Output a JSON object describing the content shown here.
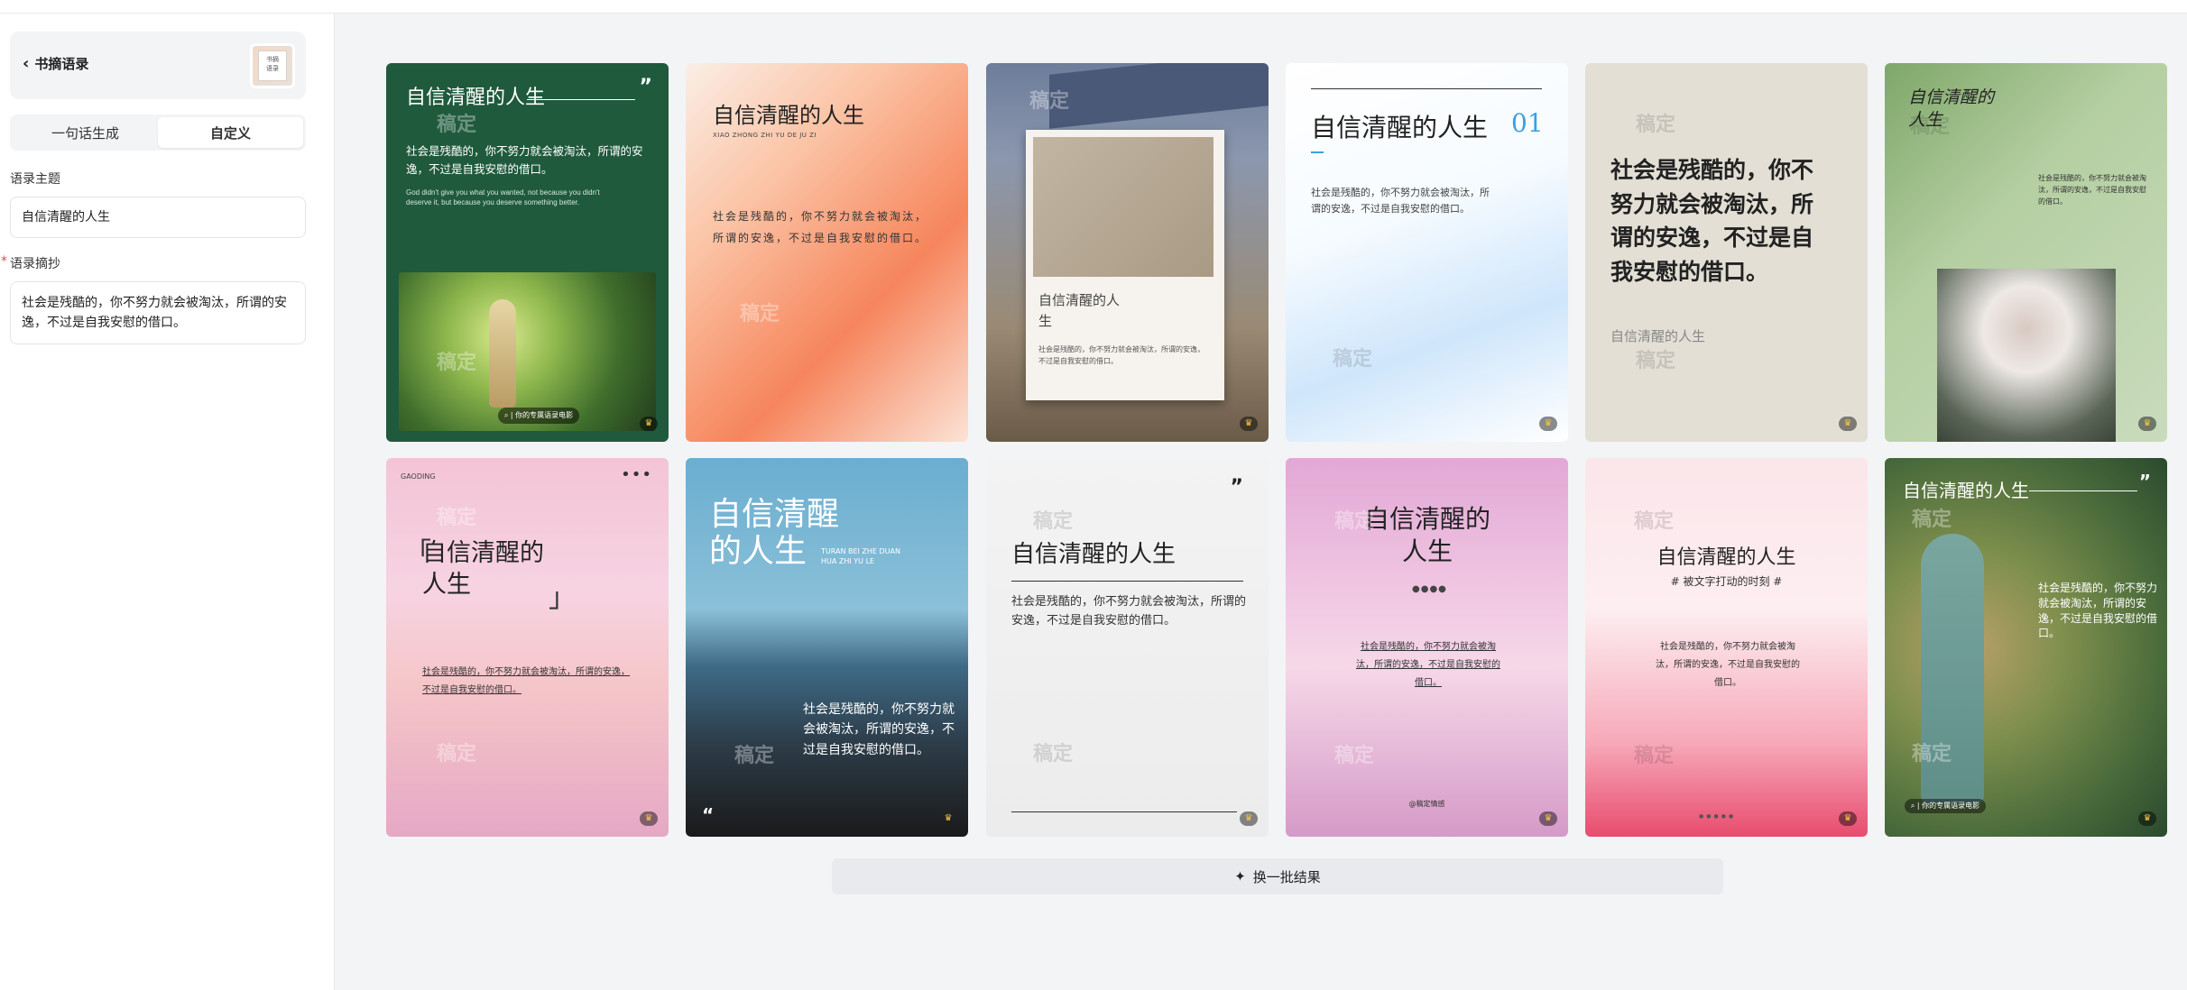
{
  "sidebar": {
    "back_label": "书摘语录",
    "thumb_text": "书摘\n语录",
    "tabs": [
      "一句话生成",
      "自定义"
    ],
    "topic_label": "语录主题",
    "topic_value": "自信清醒的人生",
    "excerpt_label": "语录摘抄",
    "excerpt_value": "社会是残酷的，你不努力就会被淘汰，所谓的安逸，不过是自我安慰的借口。"
  },
  "watermark": "稿定",
  "cards": [
    {
      "title": "自信清醒的人生",
      "body": "社会是残酷的，你不努力就会被淘汰，所谓的安逸，不过是自我安慰的借口。",
      "en": "God didn't give you what you wanted, not because you didn't deserve it, but because you deserve something better.",
      "tag": "| 你的专属语录电影"
    },
    {
      "title": "自信清醒的人生",
      "sub": "XIAO ZHONG ZHI YU DE JU ZI",
      "body": "社会是残酷的，你不努力就会被淘汰，所谓的安逸，不过是自我安慰的借口。"
    },
    {
      "title": "自信清醒的人生",
      "body": "社会是残酷的，你不努力就会被淘汰，所谓的安逸，不过是自我安慰的借口。"
    },
    {
      "title": "自信清醒的人生",
      "num": "01",
      "body": "社会是残酷的，你不努力就会被淘汰，所谓的安逸，不过是自我安慰的借口。"
    },
    {
      "title": "社会是残酷的，你不努力就会被淘汰，所谓的安逸，不过是自我安慰的借口。",
      "sub": "自信清醒的人生"
    },
    {
      "title": "自信清醒的人生",
      "body": "社会是残酷的，你不努力就会被淘汰，所谓的安逸，不过是自我安慰的借口。"
    },
    {
      "brand": "GAODING",
      "title": "自信清醒的人生",
      "body": "社会是残酷的，你不努力就会被淘汰，所谓的安逸，不过是自我安慰的借口。"
    },
    {
      "title": "自信清醒的人生",
      "sub": "TURAN BEI ZHE DUAN HUA ZHI YU LE",
      "body": "社会是残酷的，你不努力就会被淘汰，所谓的安逸，不过是自我安慰的借口。"
    },
    {
      "title": "自信清醒的人生",
      "body": "社会是残酷的，你不努力就会被淘汰，所谓的安逸，不过是自我安慰的借口。"
    },
    {
      "title": "自信清醒的人生",
      "body": "社会是残酷的，你不努力就会被淘汰，所谓的安逸，不过是自我安慰的借口。",
      "tag": "@稿定情感"
    },
    {
      "title": "自信清醒的人生",
      "sub": "# 被文字打动的时刻 #",
      "body": "社会是残酷的，你不努力就会被淘汰，所谓的安逸，不过是自我安慰的借口。"
    },
    {
      "title": "自信清醒的人生",
      "body": "社会是残酷的，你不努力就会被淘汰，所谓的安逸，不过是自我安慰的借口。",
      "tag": "| 你的专属语录电影"
    }
  ],
  "more_button": "换一批结果",
  "colors": {
    "accent": "#2b6cff",
    "required": "#e5484d"
  }
}
